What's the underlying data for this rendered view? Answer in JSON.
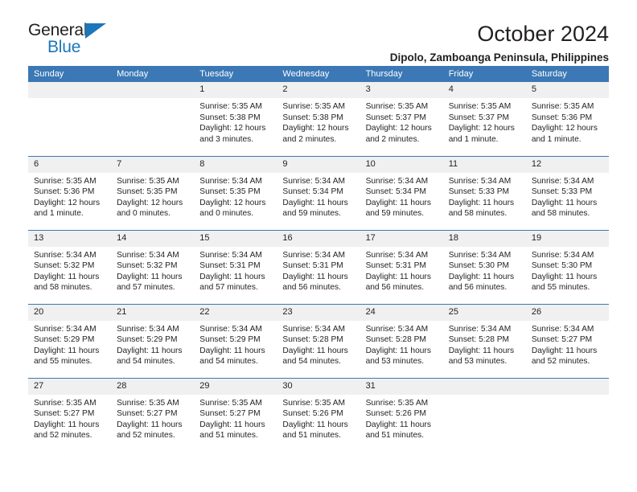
{
  "logo": {
    "word_top": "General",
    "word_bottom": "Blue",
    "triangle_icon": "triangle-icon",
    "accent_color": "#1b76bc"
  },
  "header": {
    "title": "October 2024",
    "subtitle": "Dipolo, Zamboanga Peninsula, Philippines"
  },
  "theme": {
    "header_blue": "#3b78b5",
    "daynum_band": "#f0f0f0",
    "text": "#231f20"
  },
  "calendar": {
    "weekday_headers": [
      "Sunday",
      "Monday",
      "Tuesday",
      "Wednesday",
      "Thursday",
      "Friday",
      "Saturday"
    ],
    "weeks": [
      [
        {
          "day": "",
          "blank": true
        },
        {
          "day": "",
          "blank": true
        },
        {
          "day": "1",
          "sunrise": "Sunrise: 5:35 AM",
          "sunset": "Sunset: 5:38 PM",
          "daylight": "Daylight: 12 hours and 3 minutes."
        },
        {
          "day": "2",
          "sunrise": "Sunrise: 5:35 AM",
          "sunset": "Sunset: 5:38 PM",
          "daylight": "Daylight: 12 hours and 2 minutes."
        },
        {
          "day": "3",
          "sunrise": "Sunrise: 5:35 AM",
          "sunset": "Sunset: 5:37 PM",
          "daylight": "Daylight: 12 hours and 2 minutes."
        },
        {
          "day": "4",
          "sunrise": "Sunrise: 5:35 AM",
          "sunset": "Sunset: 5:37 PM",
          "daylight": "Daylight: 12 hours and 1 minute."
        },
        {
          "day": "5",
          "sunrise": "Sunrise: 5:35 AM",
          "sunset": "Sunset: 5:36 PM",
          "daylight": "Daylight: 12 hours and 1 minute."
        }
      ],
      [
        {
          "day": "6",
          "sunrise": "Sunrise: 5:35 AM",
          "sunset": "Sunset: 5:36 PM",
          "daylight": "Daylight: 12 hours and 1 minute."
        },
        {
          "day": "7",
          "sunrise": "Sunrise: 5:35 AM",
          "sunset": "Sunset: 5:35 PM",
          "daylight": "Daylight: 12 hours and 0 minutes."
        },
        {
          "day": "8",
          "sunrise": "Sunrise: 5:34 AM",
          "sunset": "Sunset: 5:35 PM",
          "daylight": "Daylight: 12 hours and 0 minutes."
        },
        {
          "day": "9",
          "sunrise": "Sunrise: 5:34 AM",
          "sunset": "Sunset: 5:34 PM",
          "daylight": "Daylight: 11 hours and 59 minutes."
        },
        {
          "day": "10",
          "sunrise": "Sunrise: 5:34 AM",
          "sunset": "Sunset: 5:34 PM",
          "daylight": "Daylight: 11 hours and 59 minutes."
        },
        {
          "day": "11",
          "sunrise": "Sunrise: 5:34 AM",
          "sunset": "Sunset: 5:33 PM",
          "daylight": "Daylight: 11 hours and 58 minutes."
        },
        {
          "day": "12",
          "sunrise": "Sunrise: 5:34 AM",
          "sunset": "Sunset: 5:33 PM",
          "daylight": "Daylight: 11 hours and 58 minutes."
        }
      ],
      [
        {
          "day": "13",
          "sunrise": "Sunrise: 5:34 AM",
          "sunset": "Sunset: 5:32 PM",
          "daylight": "Daylight: 11 hours and 58 minutes."
        },
        {
          "day": "14",
          "sunrise": "Sunrise: 5:34 AM",
          "sunset": "Sunset: 5:32 PM",
          "daylight": "Daylight: 11 hours and 57 minutes."
        },
        {
          "day": "15",
          "sunrise": "Sunrise: 5:34 AM",
          "sunset": "Sunset: 5:31 PM",
          "daylight": "Daylight: 11 hours and 57 minutes."
        },
        {
          "day": "16",
          "sunrise": "Sunrise: 5:34 AM",
          "sunset": "Sunset: 5:31 PM",
          "daylight": "Daylight: 11 hours and 56 minutes."
        },
        {
          "day": "17",
          "sunrise": "Sunrise: 5:34 AM",
          "sunset": "Sunset: 5:31 PM",
          "daylight": "Daylight: 11 hours and 56 minutes."
        },
        {
          "day": "18",
          "sunrise": "Sunrise: 5:34 AM",
          "sunset": "Sunset: 5:30 PM",
          "daylight": "Daylight: 11 hours and 56 minutes."
        },
        {
          "day": "19",
          "sunrise": "Sunrise: 5:34 AM",
          "sunset": "Sunset: 5:30 PM",
          "daylight": "Daylight: 11 hours and 55 minutes."
        }
      ],
      [
        {
          "day": "20",
          "sunrise": "Sunrise: 5:34 AM",
          "sunset": "Sunset: 5:29 PM",
          "daylight": "Daylight: 11 hours and 55 minutes."
        },
        {
          "day": "21",
          "sunrise": "Sunrise: 5:34 AM",
          "sunset": "Sunset: 5:29 PM",
          "daylight": "Daylight: 11 hours and 54 minutes."
        },
        {
          "day": "22",
          "sunrise": "Sunrise: 5:34 AM",
          "sunset": "Sunset: 5:29 PM",
          "daylight": "Daylight: 11 hours and 54 minutes."
        },
        {
          "day": "23",
          "sunrise": "Sunrise: 5:34 AM",
          "sunset": "Sunset: 5:28 PM",
          "daylight": "Daylight: 11 hours and 54 minutes."
        },
        {
          "day": "24",
          "sunrise": "Sunrise: 5:34 AM",
          "sunset": "Sunset: 5:28 PM",
          "daylight": "Daylight: 11 hours and 53 minutes."
        },
        {
          "day": "25",
          "sunrise": "Sunrise: 5:34 AM",
          "sunset": "Sunset: 5:28 PM",
          "daylight": "Daylight: 11 hours and 53 minutes."
        },
        {
          "day": "26",
          "sunrise": "Sunrise: 5:34 AM",
          "sunset": "Sunset: 5:27 PM",
          "daylight": "Daylight: 11 hours and 52 minutes."
        }
      ],
      [
        {
          "day": "27",
          "sunrise": "Sunrise: 5:35 AM",
          "sunset": "Sunset: 5:27 PM",
          "daylight": "Daylight: 11 hours and 52 minutes."
        },
        {
          "day": "28",
          "sunrise": "Sunrise: 5:35 AM",
          "sunset": "Sunset: 5:27 PM",
          "daylight": "Daylight: 11 hours and 52 minutes."
        },
        {
          "day": "29",
          "sunrise": "Sunrise: 5:35 AM",
          "sunset": "Sunset: 5:27 PM",
          "daylight": "Daylight: 11 hours and 51 minutes."
        },
        {
          "day": "30",
          "sunrise": "Sunrise: 5:35 AM",
          "sunset": "Sunset: 5:26 PM",
          "daylight": "Daylight: 11 hours and 51 minutes."
        },
        {
          "day": "31",
          "sunrise": "Sunrise: 5:35 AM",
          "sunset": "Sunset: 5:26 PM",
          "daylight": "Daylight: 11 hours and 51 minutes."
        },
        {
          "day": "",
          "blank": true
        },
        {
          "day": "",
          "blank": true
        }
      ]
    ]
  }
}
